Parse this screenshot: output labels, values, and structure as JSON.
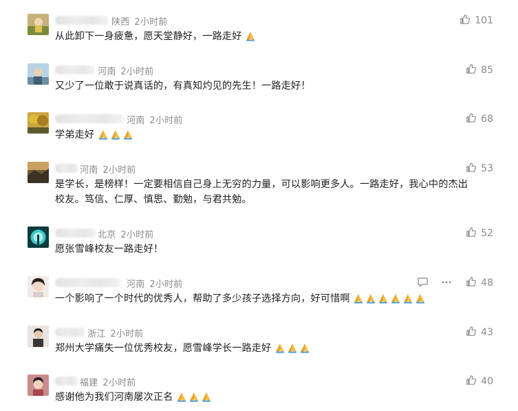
{
  "comments": [
    {
      "location": "陕西",
      "time": "2小时前",
      "likes": "101",
      "text": "从此卸下一身疲惫，愿天堂静好，一路走好",
      "emoji_count": 1
    },
    {
      "location": "河南",
      "time": "2小时前",
      "likes": "85",
      "text": "又少了一位敢于说真话的，有真知灼见的先生！一路走好！",
      "emoji_count": 0
    },
    {
      "location": "河南",
      "time": "2小时前",
      "likes": "68",
      "text": "学弟走好",
      "emoji_count": 3
    },
    {
      "location": "河南",
      "time": "2小时前",
      "likes": "53",
      "text": "是学长，是榜样！一定要相信自己身上无穷的力量，可以影响更多人。一路走好，我心中的杰出",
      "text2": "校友。笃信、仁厚、慎思、勤勉，与君共勉。",
      "emoji_count": 0
    },
    {
      "location": "北京",
      "time": "2小时前",
      "likes": "52",
      "text": "愿张雪峰校友一路走好！",
      "emoji_count": 0
    },
    {
      "location": "河南",
      "time": "2小时前",
      "likes": "48",
      "text": "一个影响了一个时代的优秀人，帮助了多少孩子选择方向，好可惜啊",
      "emoji_count": 6
    },
    {
      "location": "浙江",
      "time": "2小时前",
      "likes": "43",
      "text": "郑州大学痛失一位优秀校友，愿雪峰学长一路走好",
      "emoji_count": 3
    },
    {
      "location": "福建",
      "time": "2小时前",
      "likes": "40",
      "text": "感谢他为我们河南屡次正名",
      "emoji_count": 3
    }
  ],
  "icons": {
    "like": "thumbs-up-icon",
    "reply": "comment-icon",
    "more": "more-dots-icon",
    "emoji": "folded-hands-emoji"
  },
  "colors": {
    "meta": "#8a8a8a",
    "text": "#222222",
    "emoji": "#e9a62b"
  }
}
